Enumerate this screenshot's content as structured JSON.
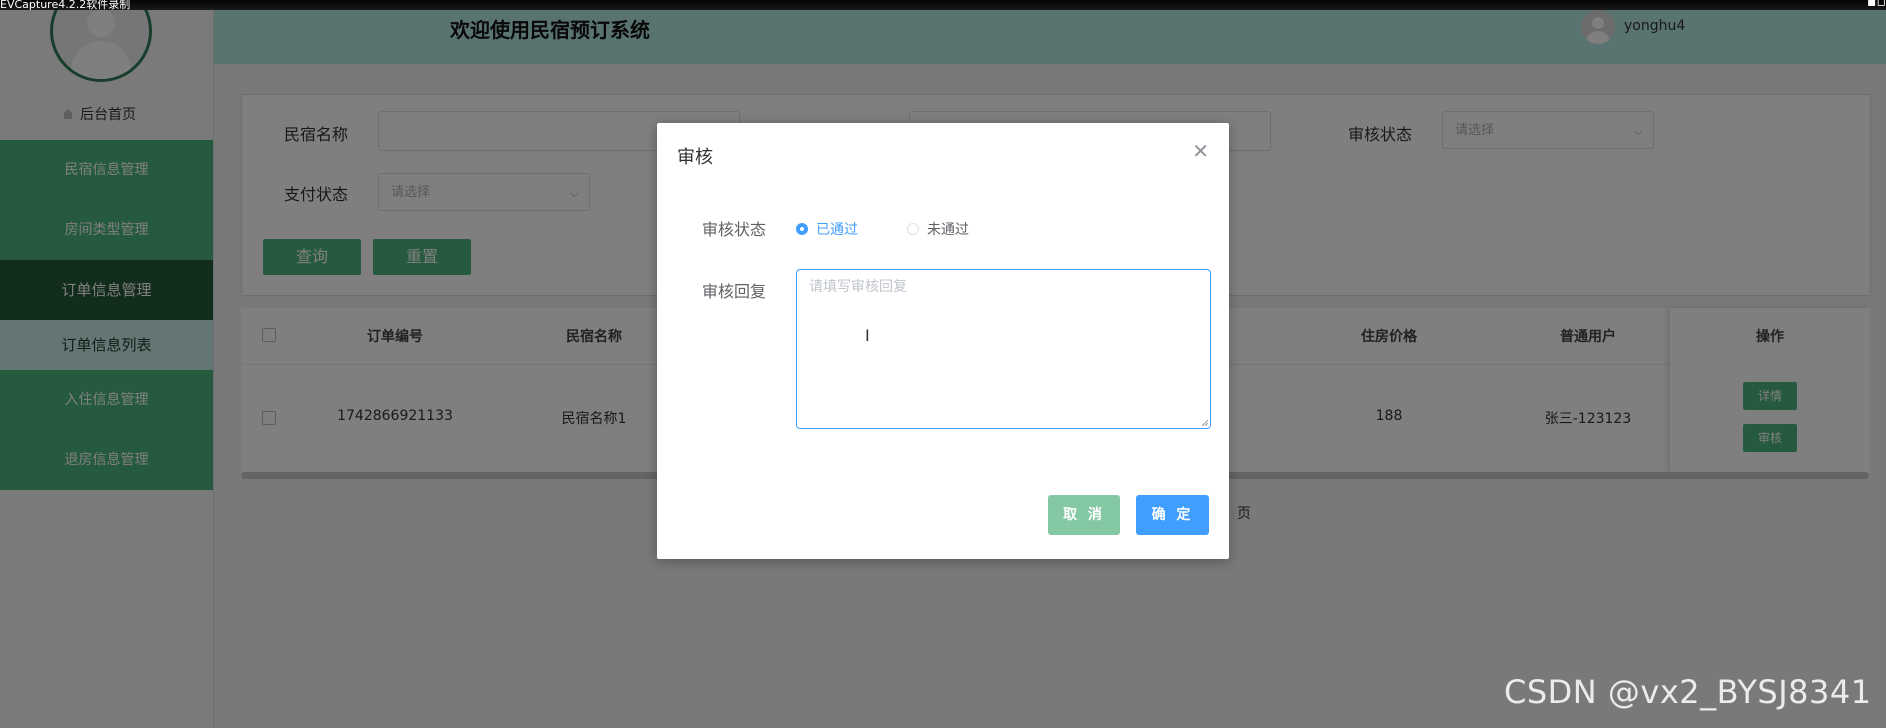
{
  "window": {
    "capture_title": "EVCapture4.2.2软件录制"
  },
  "sidebar": {
    "home_label": "后台首页",
    "items": [
      {
        "label": "民宿信息管理"
      },
      {
        "label": "房间类型管理"
      },
      {
        "label": "订单信息管理"
      },
      {
        "label": "订单信息列表"
      },
      {
        "label": "入住信息管理"
      },
      {
        "label": "退房信息管理"
      }
    ]
  },
  "header": {
    "title": "欢迎使用民宿预订系统",
    "username": "yonghu4"
  },
  "filter": {
    "name_label": "民宿名称",
    "audit_label": "审核状态",
    "audit_placeholder": "请选择",
    "pay_label": "支付状态",
    "pay_placeholder": "请选择",
    "query_button": "查询",
    "reset_button": "重置"
  },
  "table": {
    "columns": [
      "订单编号",
      "民宿名称",
      "住房价格",
      "普通用户",
      "操作"
    ],
    "rows": [
      {
        "order_no": "1742866921133",
        "homestay": "民宿名称1",
        "price": "188",
        "user": "张三-123123"
      }
    ],
    "detail_button": "详情",
    "audit_button": "审核"
  },
  "pagination": {
    "page_suffix": "页"
  },
  "dialog": {
    "title": "审核",
    "status_label": "审核状态",
    "options": [
      "已通过",
      "未通过"
    ],
    "selected": "已通过",
    "reply_label": "审核回复",
    "reply_placeholder": "请填写审核回复",
    "reply_value": "",
    "cancel_button": "取 消",
    "confirm_button": "确 定"
  },
  "watermark": "CSDN @vx2_BYSJ8341",
  "colors": {
    "sidebar_green": "#4cb57c",
    "sidebar_active": "#245a36",
    "header_bg": "#b3e7e0",
    "primary_blue": "#409eff"
  }
}
